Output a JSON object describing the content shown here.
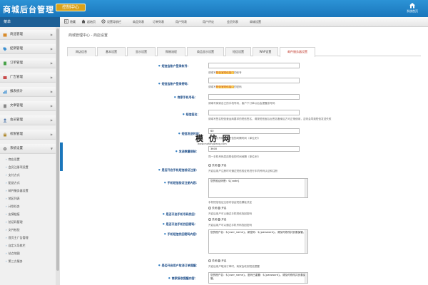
{
  "header": {
    "logo_text": "商城后台管理",
    "badge": "控制中心",
    "home_label": "系统首页"
  },
  "nav": {
    "menu_label": "菜单",
    "items": [
      {
        "label": "隐藏",
        "icon": "hide-icon"
      },
      {
        "label": "起始页",
        "icon": "home-icon"
      },
      {
        "label": "设置导航栏",
        "icon": "settings-icon"
      },
      {
        "label": "商品列表"
      },
      {
        "label": "订单列表"
      },
      {
        "label": "用户列表"
      },
      {
        "label": "用户评论"
      },
      {
        "label": "会员列表"
      },
      {
        "label": "商城设置"
      }
    ]
  },
  "sidebar": {
    "groups": [
      {
        "label": "商品管理",
        "icon": "box-icon"
      },
      {
        "label": "促销管理",
        "icon": "tag-icon"
      },
      {
        "label": "订单管理",
        "icon": "order-icon"
      },
      {
        "label": "广告管理",
        "icon": "ad-icon"
      },
      {
        "label": "报表统计",
        "icon": "chart-icon"
      },
      {
        "label": "文章管理",
        "icon": "doc-icon"
      },
      {
        "label": "会员管理",
        "icon": "user-icon"
      },
      {
        "label": "权限管理",
        "icon": "lock-icon"
      },
      {
        "label": "系统设置",
        "icon": "gear-icon"
      }
    ],
    "sub_items": [
      "商店设置",
      "会员注册项设置",
      "支付方式",
      "配送方式",
      "邮件服务器设置",
      "地区列表",
      "计划任务",
      "友情链接",
      "验证码管理",
      "文件校验",
      "首页主广告管理",
      "自定义导航栏",
      "站点地图",
      "第三方服务"
    ]
  },
  "breadcrumb": "商城管理中心 - 商店设置",
  "tabs": [
    "网店信息",
    "基本设置",
    "显示设置",
    "购物流程",
    "商品显示设置",
    "短信设置",
    "WAP设置",
    "邮件服务器设置"
  ],
  "active_tab": 7,
  "form": {
    "sms_account_label": "短信宝账户登录帐号：",
    "sms_account_hint_pre": "请填写",
    "sms_account_hint_hl": "短信宝短信接口",
    "sms_account_hint_post": "的帐号",
    "sms_password_label": "短信宝账户登录密码：",
    "sms_password_hint_pre": "请填写",
    "sms_password_hint_hl": "短信宝短信接口",
    "sms_password_hint_post": "的密码",
    "shop_mobile_label": "商家手机号码：",
    "shop_mobile_hint": "请填写商家自己的手机号码，客户下订单以后会提醒该号码",
    "sms_sign_label": "短信签名：",
    "sms_sign_hint": "请填写签名短信营运商要求的短信签名，请按短信宝后台签名备案后方可正常使用，否则会导致短信发送失败",
    "send_interval_label": "短信发送时间：",
    "send_interval_value": "60",
    "send_interval_hint": "同一手机号码发送短信的间隔时间（单位/秒）",
    "send_limit_label": "发送数量限制：",
    "send_limit_value": "3600",
    "send_limit_hint": "同一手机号码发送短信的时间间隔（单位/秒）",
    "verify_on_label": "是否开启手机短信验证注册：",
    "yes": "开启",
    "no": "关闭",
    "verify_on_hint": "开启后用户注册时可通过短信验证码进行手机号码认证和注册",
    "verify_content_label": "手机短信验证注册内容：",
    "verify_content_value": "您的验证码是：${code}",
    "verify_content_hint": "手机短信验证注册内容由短信模板决定",
    "find_pwd_label": "是否开启手机号码找回：",
    "find_pwd_hint": "开启后用户可以通过手机短信找回密码",
    "find_pwd_content_label": "手机找回密码短信内容：",
    "find_pwd_content_value": "您的验证码是：${code}",
    "bind_pwd_label": "是否开启手机找回密码：",
    "bind_pwd_hint": "开启后用户可以通过手机号码找回密码",
    "order_msg_label": "手机短信找回密码内容：",
    "order_msg_value": "您的账户名：${user_name}，新密码：${password}。请及时修改并妥善保管。",
    "order_msg_hint": "请填写手机短信找回密码的内容",
    "remind_label": "是否开启用户取消订单提醒：",
    "remind_hint": "开启后用户取消订单时，商家会收到短信提醒",
    "pay_remind_label": "商家接收提醒内容：",
    "pay_remind_value": "您的账户名：${user_name}，密码已重置：${password}。请及时修改并妥善保管。"
  },
  "watermark": {
    "text": "模 仿 网",
    "url": "www.mofangwang.com"
  }
}
